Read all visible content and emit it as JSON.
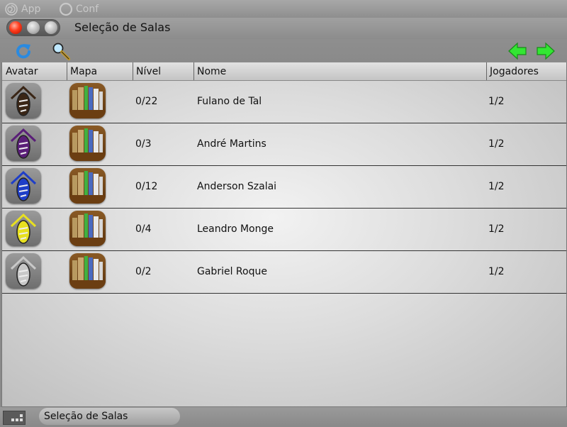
{
  "menubar": {
    "items": [
      {
        "label": "App",
        "icon": "spiral-icon"
      },
      {
        "label": "Conf",
        "icon": "circle-icon"
      }
    ]
  },
  "window": {
    "title": "Seleção de Salas"
  },
  "toolbar": {
    "refresh_icon": "refresh-icon",
    "search_icon": "magnifier-icon",
    "prev_icon": "arrow-left-icon",
    "next_icon": "arrow-right-icon"
  },
  "table": {
    "columns": [
      "Avatar",
      "Mapa",
      "Nível",
      "Nome",
      "Jogadores"
    ],
    "rows": [
      {
        "avatar_color": "#3a2616",
        "level": "0/22",
        "name": "Fulano de Tal",
        "players": "1/2"
      },
      {
        "avatar_color": "#5a1e78",
        "level": "0/3",
        "name": "André Martins",
        "players": "1/2"
      },
      {
        "avatar_color": "#1e3ec8",
        "level": "0/12",
        "name": "Anderson Szalai",
        "players": "1/2"
      },
      {
        "avatar_color": "#e8e020",
        "level": "0/4",
        "name": "Leandro Monge",
        "players": "1/2"
      },
      {
        "avatar_color": "#c8c8c8",
        "level": "0/2",
        "name": "Gabriel Roque",
        "players": "1/2"
      }
    ]
  },
  "taskbar": {
    "tab_label": "Seleção de Salas"
  },
  "colors": {
    "close": "#ff3a1a",
    "nav_arrows": "#33e633",
    "refresh": "#2a8ae0"
  }
}
